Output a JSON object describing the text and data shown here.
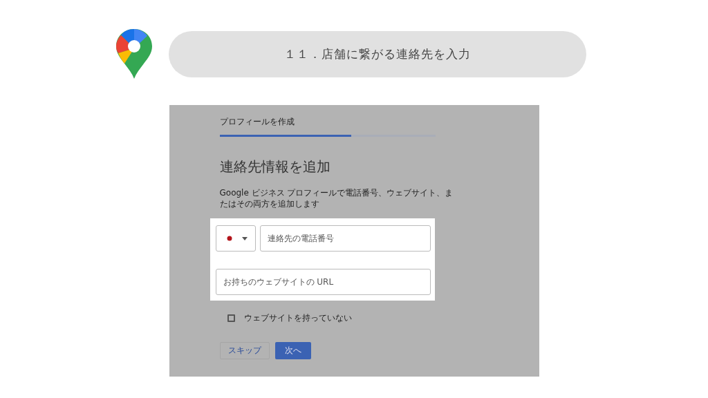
{
  "header": {
    "title": "１１．店舗に繋がる連絡先を入力"
  },
  "screenshot": {
    "step_label": "プロフィールを作成",
    "progress": {
      "level": 0.61
    },
    "heading": "連絡先情報を追加",
    "description": "Google ビジネス プロフィールで電話番号、ウェブサイト、またはその両方を追加します",
    "phone": {
      "placeholder": "連絡先の電話番号"
    },
    "website": {
      "placeholder": "お持ちのウェブサイトの URL"
    },
    "no_website": {
      "label": "ウェブサイトを持っていない",
      "checked": false
    },
    "buttons": [
      {
        "label": "スキップ",
        "kind": "secondary"
      },
      {
        "label": "次へ",
        "kind": "primary"
      }
    ]
  }
}
